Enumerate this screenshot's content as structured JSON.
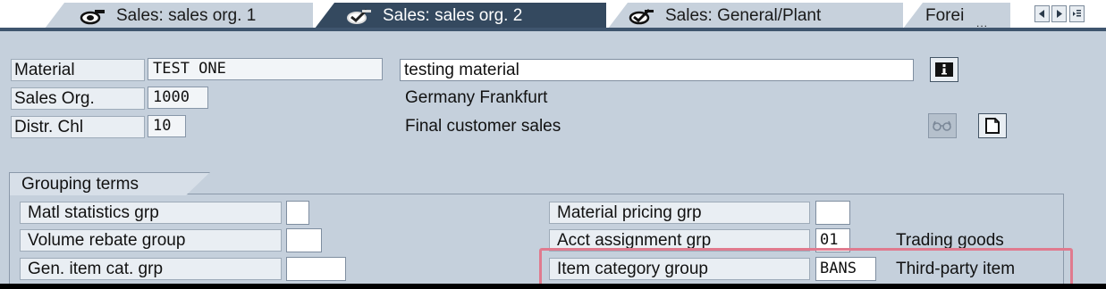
{
  "tabs": [
    {
      "label": "Sales: sales org. 1",
      "icon": "mixed-status-icon",
      "active": false
    },
    {
      "label": "Sales: sales org. 2",
      "icon": "checked-status-icon",
      "active": true
    },
    {
      "label": "Sales: General/Plant",
      "icon": "checked-status-icon",
      "active": false
    },
    {
      "label": "Forei",
      "icon": "",
      "active": false
    }
  ],
  "tabs_more": "...",
  "header": {
    "material_label": "Material",
    "material_value": "TEST ONE",
    "material_description": "testing material",
    "sales_org_label": "Sales Org.",
    "sales_org_value": "1000",
    "sales_org_description": "Germany Frankfurt",
    "distr_chl_label": "Distr. Chl",
    "distr_chl_value": "10",
    "distr_chl_description": "Final customer sales"
  },
  "grouping": {
    "title": "Grouping terms",
    "matl_statistics_label": "Matl statistics grp",
    "matl_statistics_value": "",
    "volume_rebate_label": "Volume rebate group",
    "volume_rebate_value": "",
    "gen_item_cat_label": "Gen. item cat. grp",
    "gen_item_cat_value": "",
    "material_pricing_label": "Material pricing grp",
    "material_pricing_value": "",
    "acct_assignment_label": "Acct assignment grp",
    "acct_assignment_value": "01",
    "acct_assignment_text": "Trading goods",
    "item_category_label": "Item category group",
    "item_category_value": "BANS",
    "item_category_text": "Third-party item"
  },
  "colors": {
    "screen_bg": "#c5d0dc",
    "active_tab": "#34495f",
    "highlight": "#e07a8e"
  }
}
